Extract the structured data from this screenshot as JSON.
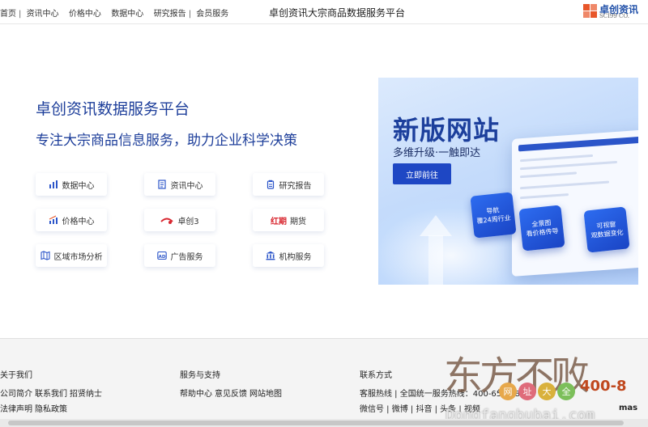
{
  "topbar": {
    "links": [
      "首页",
      "资讯中心",
      "价格中心",
      "数据中心",
      "研究报告",
      "会员服务"
    ],
    "site_title": "卓创资讯大宗商品数据服务平台",
    "logo_cn": "卓创资讯",
    "logo_en": "SCI99 CO."
  },
  "intro": {
    "heading": "卓创资讯数据服务平台",
    "subheading": "专注大宗商品信息服务，助力企业科学决策"
  },
  "tiles": [
    {
      "icon": "bar-chart-icon",
      "label": "数据中心"
    },
    {
      "icon": "document-icon",
      "label": "资讯中心"
    },
    {
      "icon": "report-icon",
      "label": "研究报告"
    },
    {
      "icon": "trend-chart-icon",
      "label": "价格中心"
    },
    {
      "icon": "brand-logo-icon",
      "label": "卓创3",
      "badge": "卓创"
    },
    {
      "icon": "red-futures-logo",
      "label": "期货",
      "badge": "红期"
    },
    {
      "icon": "map-icon",
      "label": "区域市场分析"
    },
    {
      "icon": "ad-icon",
      "label": "广告服务"
    },
    {
      "icon": "bank-icon",
      "label": "机构服务"
    }
  ],
  "banner": {
    "title": "新版网站",
    "subtitle": "多维升级·一触即达",
    "button": "立即前往",
    "cards": [
      "导航\n覆24周行业",
      "全景图\n看价格传导",
      "可视窗\n观数据变化"
    ]
  },
  "footer": {
    "col1": {
      "title": "关于我们",
      "links": [
        "公司简介",
        "联系我们",
        "招贤纳士",
        "法律声明",
        "隐私政策"
      ]
    },
    "col2": {
      "title": "服务与支持",
      "links": [
        "帮助中心",
        "意见反馈",
        "网站地图"
      ]
    },
    "col3": {
      "title": "联系方式",
      "line1": "客服热线 | 全国统一服务热线：400-658-1860",
      "line2": "微信号 | 微博 | 抖音 | 头条 | 视频"
    }
  },
  "watermark": {
    "big": "东方不败",
    "chars": [
      "网",
      "址",
      "大",
      "全"
    ],
    "number": "400-8",
    "url": "Dongfangbubai.com",
    "tail": "mas"
  },
  "colors": {
    "primary": "#1d3e9a",
    "button": "#1e47c4",
    "logo_accent": "#e8562a",
    "footer_bg": "#f4f4f4"
  }
}
